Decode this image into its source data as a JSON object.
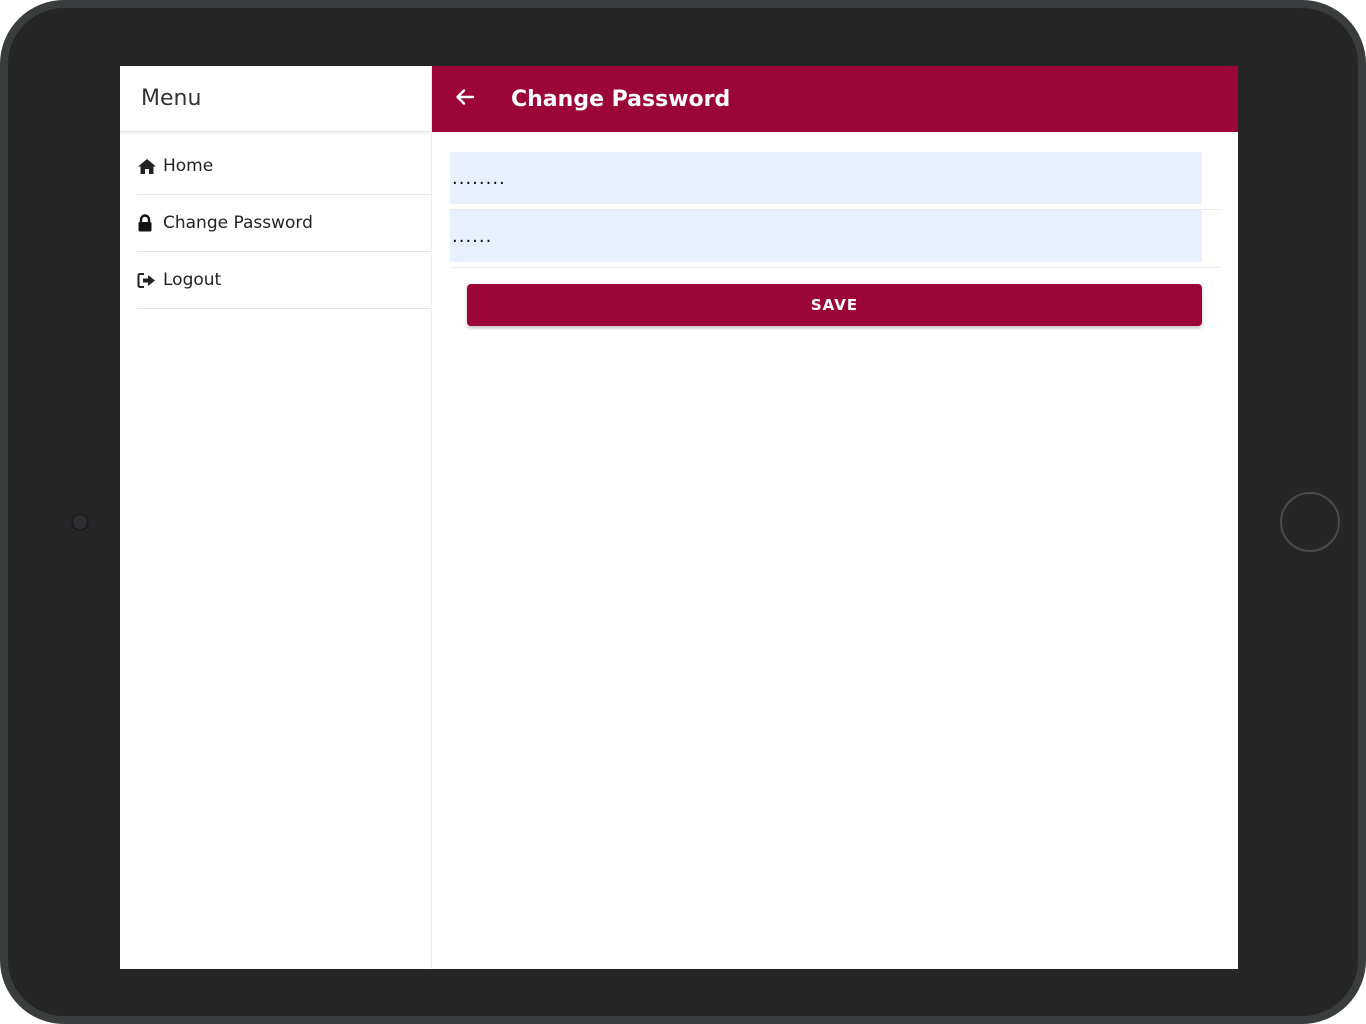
{
  "sidebar": {
    "title": "Menu",
    "items": [
      {
        "label": "Home",
        "icon": "home-icon"
      },
      {
        "label": "Change Password",
        "icon": "lock-icon"
      },
      {
        "label": "Logout",
        "icon": "logout-icon"
      }
    ]
  },
  "header": {
    "back_icon": "arrow-left-icon",
    "title": "Change Password"
  },
  "form": {
    "current_password_value": "........",
    "new_password_value": "......",
    "save_label": "SAVE"
  },
  "colors": {
    "brand": "#9c0537",
    "input_bg": "#e8f0fe",
    "device_frame": "#262626"
  }
}
